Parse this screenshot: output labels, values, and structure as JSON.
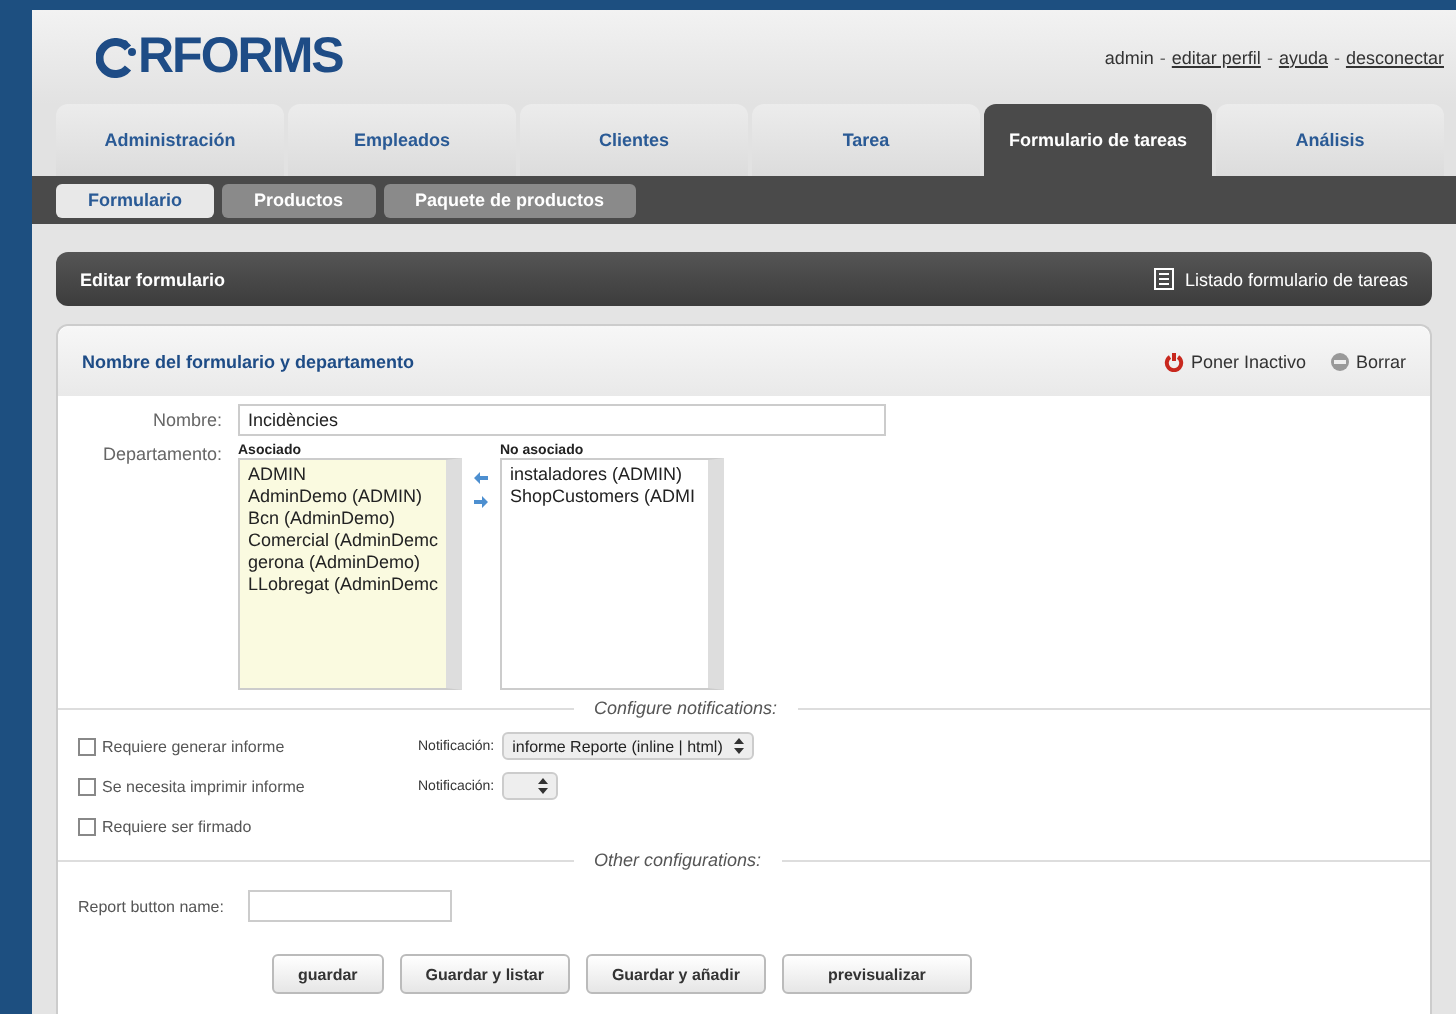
{
  "logo": {
    "text": "RFORMS"
  },
  "user_separator": "-",
  "user_links": [
    {
      "text": "admin",
      "link": false
    },
    {
      "text": "editar perfil",
      "link": true
    },
    {
      "text": "ayuda",
      "link": true
    },
    {
      "text": "desconectar",
      "link": true
    }
  ],
  "tabs": [
    {
      "label": "Administración",
      "selected": false
    },
    {
      "label": "Empleados",
      "selected": false
    },
    {
      "label": "Clientes",
      "selected": false
    },
    {
      "label": "Tarea",
      "selected": false
    },
    {
      "label": "Formulario de tareas",
      "selected": true
    },
    {
      "label": "Análisis",
      "selected": false
    }
  ],
  "subtabs": [
    {
      "label": "Formulario",
      "selected": true
    },
    {
      "label": "Productos",
      "selected": false
    },
    {
      "label": "Paquete de productos",
      "selected": false
    }
  ],
  "section_bar": {
    "title": "Editar formulario",
    "link": "Listado formulario de tareas"
  },
  "card": {
    "title": "Nombre del formulario y departamento",
    "actions": [
      {
        "kind": "power",
        "label": "Poner Inactivo"
      },
      {
        "kind": "delete",
        "label": "Borrar"
      }
    ]
  },
  "name_field": {
    "label": "Nombre:",
    "value": "Incidències"
  },
  "department": {
    "label": "Departamento:",
    "associated": {
      "title": "Asociado",
      "items": [
        "ADMIN",
        "AdminDemo (ADMIN)",
        "Bcn (AdminDemo)",
        "Comercial (AdminDemc",
        "gerona (AdminDemo)",
        "LLobregat (AdminDemc"
      ]
    },
    "not_associated": {
      "title": "No asociado",
      "items": [
        "instaladores (ADMIN)",
        "ShopCustomers (ADMI"
      ]
    }
  },
  "notifications": {
    "heading": "Configure notifications:",
    "rows": [
      {
        "label": "Requiere generar informe",
        "checked": false,
        "select_label": "Notificación:",
        "select_value": "informe Reporte (inline | html)"
      },
      {
        "label": "Se necesita imprimir informe",
        "checked": false,
        "select_label": "Notificación:",
        "select_value": ""
      },
      {
        "label": "Requiere ser firmado",
        "checked": false
      }
    ]
  },
  "other": {
    "heading": "Other configurations:",
    "report_label": "Report button name:"
  },
  "buttons": [
    "guardar",
    "Guardar y listar",
    "Guardar y añadir",
    "previsualizar"
  ]
}
